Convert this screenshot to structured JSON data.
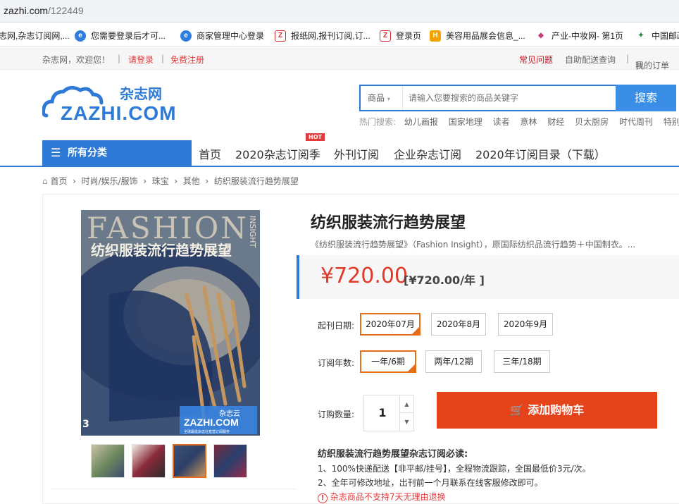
{
  "browser": {
    "url_domain": "zazhi.com",
    "url_path": "/122449",
    "bookmarks": [
      {
        "label": "志网,杂志订阅网,..."
      },
      {
        "label": "您需要登录后才可..."
      },
      {
        "label": "商家管理中心登录"
      },
      {
        "label": "报纸网,报刊订阅,订..."
      },
      {
        "label": "登录页"
      },
      {
        "label": "美容用品展会信息_..."
      },
      {
        "label": "产业-中妆网- 第1页"
      },
      {
        "label": "中国邮政"
      }
    ]
  },
  "topbar": {
    "welcome": "杂志网，欢迎您！",
    "sep": "|",
    "login": "请登录",
    "register": "免费注册",
    "faq": "常见问题",
    "self_pickup": "自助配送查询",
    "my_orders": "我的订单"
  },
  "logo": {
    "cn": "杂志网",
    "en": "ZAZHI.COM"
  },
  "search": {
    "category": "商品",
    "placeholder": "请输入您要搜索的商品关键字",
    "button": "搜索",
    "hot_label": "热门搜索:",
    "hot_terms": [
      "幼儿画报",
      "国家地理",
      "读者",
      "意林",
      "财经",
      "贝太厨房",
      "时代周刊",
      "特别关注"
    ]
  },
  "nav": {
    "all_categories": "所有分类",
    "items": [
      "首页",
      "2020杂志订阅季",
      "外刊订阅",
      "企业杂志订阅",
      "2020年订阅目录（下载）"
    ],
    "hot_badge": "HOT"
  },
  "breadcrumb": [
    "首页",
    "时尚/娱乐/服饰",
    "珠宝",
    "其他",
    "纺织服装流行趋势展望"
  ],
  "product": {
    "title": "纺织服装流行趋势展望",
    "desc": "《纺织服装流行趋势展望》（Fashion Insight），原国际纺织品流行趋势＋中国制衣。...",
    "price": "¥720.00",
    "price_per_year": "[¥720.00/年 ]",
    "start_date_label": "起刊日期:",
    "start_dates": [
      "2020年07月",
      "2020年8月",
      "2020年9月"
    ],
    "years_label": "订阅年数:",
    "years": [
      "一年/6期",
      "两年/12期",
      "三年/18期"
    ],
    "qty_label": "订购数量:",
    "qty": "1",
    "add_to_cart": "添加购物车",
    "cover": {
      "masthead": "FASHION",
      "side": "INSIGHT",
      "cn_title": "纺织服装流行趋势展望",
      "issue": "3",
      "brand": "杂志云",
      "brand_en": "ZAZHI.COM",
      "brand_tagline": "全球最低杂志社直营订阅服务"
    }
  },
  "notice": {
    "title": "纺织服装流行趋势展望杂志订阅必读:",
    "lines": [
      "1、100%快递配送【非平邮/挂号】，全程物流跟踪，全国最低价3元/次。",
      "2、全年可修改地址，出刊前一个月联系在线客服修改即可。"
    ],
    "warning": "杂志商品不支持7天无理由退换"
  },
  "colors": {
    "brand_blue": "#2e7ad6",
    "price_red": "#e23a2a",
    "select_orange": "#e46d1a",
    "cart_orange": "#e5431a"
  }
}
